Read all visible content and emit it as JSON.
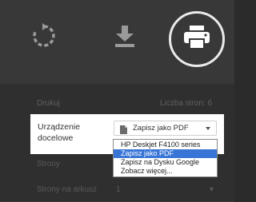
{
  "toolbar": {
    "refresh_icon": "refresh-icon",
    "download_icon": "download-icon",
    "print_icon": "printer-icon"
  },
  "print": {
    "heading": "Drukuj",
    "sheet_count": "Liczba stron: 6"
  },
  "destination": {
    "label": "Urządzenie docelowe",
    "selected": "Zapisz jako PDF",
    "options": [
      "HP Deskjet F4100 series",
      "Zapisz jako PDF",
      "Zapisz na Dysku Google",
      "Zobacz więcej..."
    ],
    "selected_index": 1
  },
  "pages": {
    "label": "Strony"
  },
  "pages_per_sheet": {
    "label": "Strony na arkusz",
    "value": "1"
  },
  "colors": {
    "selection": "#3875d7",
    "toolbar_bg": "#383838",
    "panel_bg": "#2f2f2f"
  }
}
